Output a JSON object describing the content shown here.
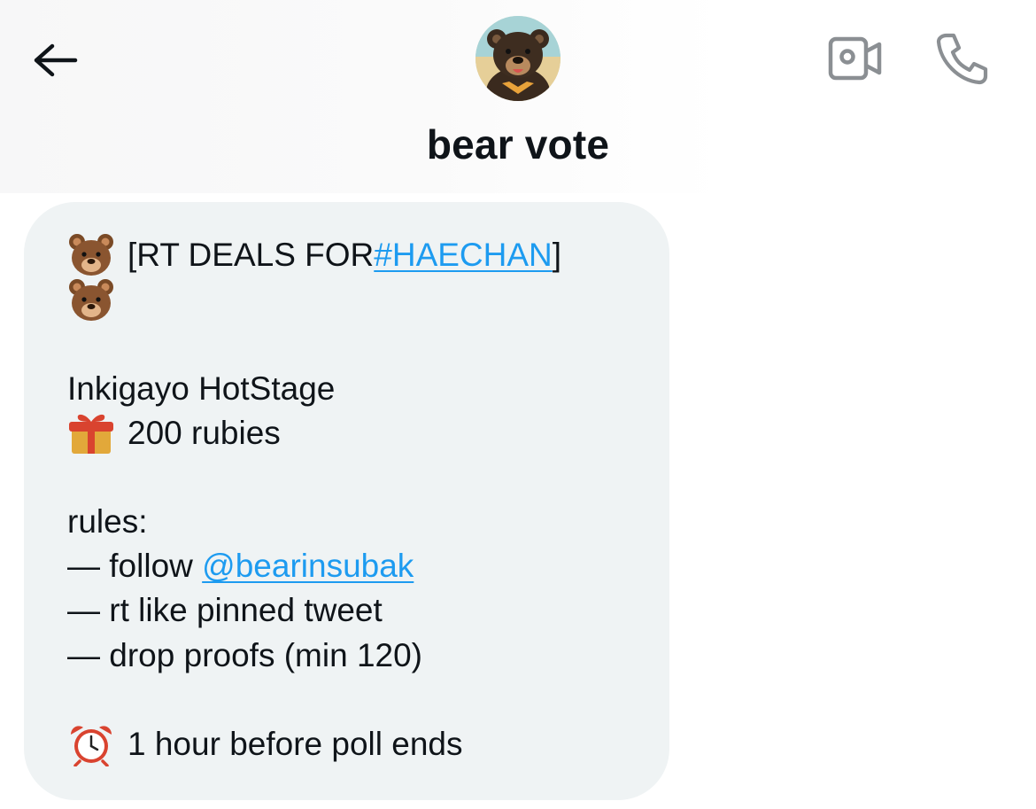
{
  "header": {
    "title": "bear vote",
    "back_icon": "arrow-left-icon",
    "video_icon": "video-camera-icon",
    "phone_icon": "phone-icon"
  },
  "message": {
    "line1_prefix": "[RT DEALS FOR ",
    "line1_link": "#HAECHAN",
    "line1_suffix": "]",
    "line3": "Inkigayo HotStage",
    "line4": "200 rubies",
    "line5": "rules:",
    "line6_prefix": "— follow ",
    "line6_link": "@bearinsubak",
    "line7": "— rt like pinned tweet",
    "line8": "— drop proofs (min 120)",
    "line9": "1 hour before poll ends",
    "emoji_bear": "bear-face-emoji",
    "emoji_gift": "gift-emoji",
    "emoji_clock": "alarm-clock-emoji"
  },
  "colors": {
    "link": "#1d9bf0",
    "bubble": "#eff3f4",
    "icon_gray": "#8b8f93",
    "text": "#0f1419"
  }
}
